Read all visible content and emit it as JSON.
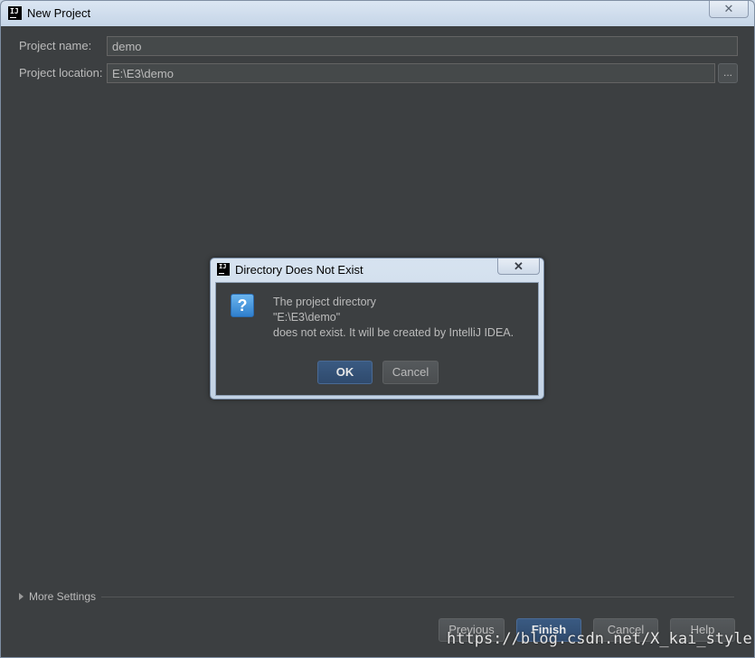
{
  "window": {
    "title": "New Project",
    "icon": "intellij-idea-icon",
    "close_glyph": "✕"
  },
  "form": {
    "project_name_label": "Project name:",
    "project_name_value": "demo",
    "project_location_label": "Project location:",
    "project_location_value": "E:\\E3\\demo",
    "browse_label": "..."
  },
  "more_settings": {
    "label": "More Settings",
    "expanded": false
  },
  "footer": {
    "previous": "Previous",
    "finish": "Finish",
    "cancel": "Cancel",
    "help": "Help"
  },
  "dialog": {
    "title": "Directory Does Not Exist",
    "close_glyph": "✕",
    "icon": "question-icon",
    "message_line1": "The project directory",
    "message_line2": "\"E:\\E3\\demo\"",
    "message_line3": "does not exist. It will be created by IntelliJ IDEA.",
    "ok": "OK",
    "cancel": "Cancel"
  },
  "watermark": "https://blog.csdn.net/X_kai_style",
  "colors": {
    "background": "#3c3f41",
    "text": "#bbbbbb",
    "input_bg": "#45494a",
    "default_button": "#365880",
    "titlebar": "#d0deed"
  }
}
